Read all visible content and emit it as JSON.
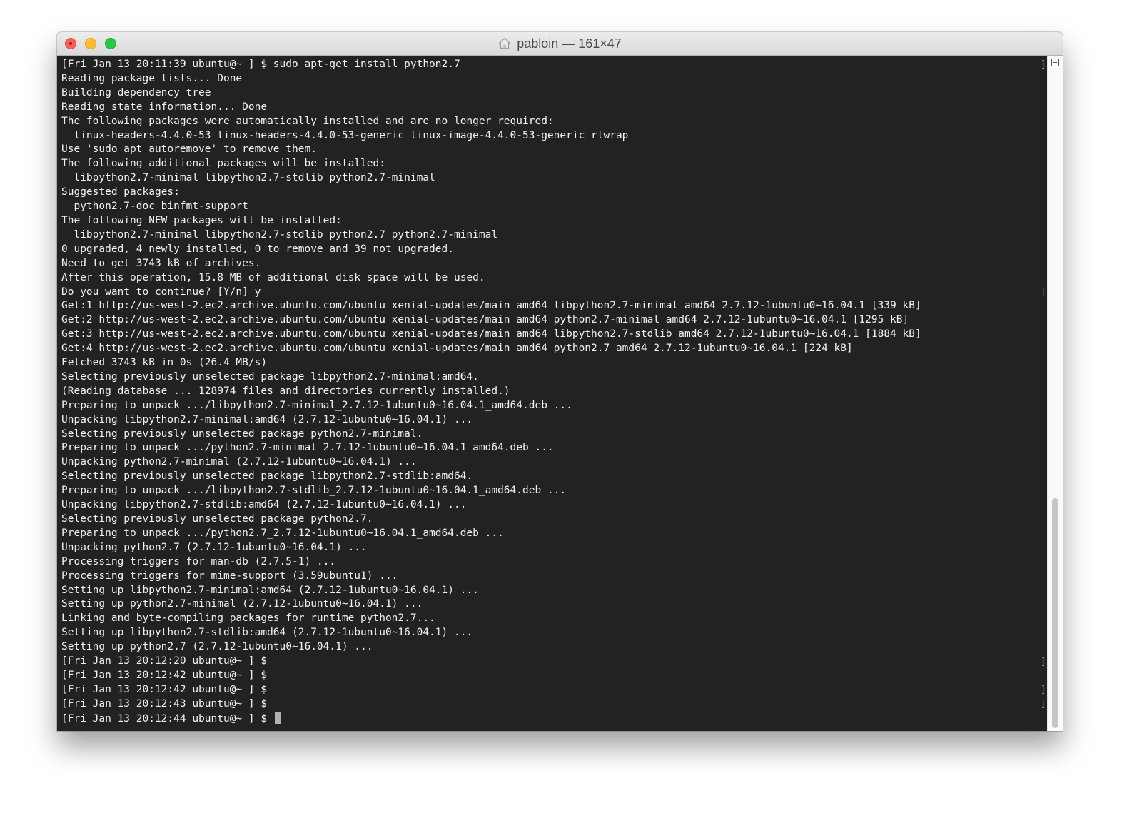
{
  "window": {
    "title": "pabloin — 161×47"
  },
  "terminal": {
    "lines": [
      {
        "text": "[Fri Jan 13 20:11:39 ubuntu@~ ] $ sudo apt-get install python2.7",
        "mark": true
      },
      {
        "text": "Reading package lists... Done"
      },
      {
        "text": "Building dependency tree"
      },
      {
        "text": "Reading state information... Done"
      },
      {
        "text": "The following packages were automatically installed and are no longer required:"
      },
      {
        "text": "  linux-headers-4.4.0-53 linux-headers-4.4.0-53-generic linux-image-4.4.0-53-generic rlwrap"
      },
      {
        "text": "Use 'sudo apt autoremove' to remove them."
      },
      {
        "text": "The following additional packages will be installed:"
      },
      {
        "text": "  libpython2.7-minimal libpython2.7-stdlib python2.7-minimal"
      },
      {
        "text": "Suggested packages:"
      },
      {
        "text": "  python2.7-doc binfmt-support"
      },
      {
        "text": "The following NEW packages will be installed:"
      },
      {
        "text": "  libpython2.7-minimal libpython2.7-stdlib python2.7 python2.7-minimal"
      },
      {
        "text": "0 upgraded, 4 newly installed, 0 to remove and 39 not upgraded."
      },
      {
        "text": "Need to get 3743 kB of archives."
      },
      {
        "text": "After this operation, 15.8 MB of additional disk space will be used."
      },
      {
        "text": "Do you want to continue? [Y/n] y",
        "mark": true
      },
      {
        "text": "Get:1 http://us-west-2.ec2.archive.ubuntu.com/ubuntu xenial-updates/main amd64 libpython2.7-minimal amd64 2.7.12-1ubuntu0~16.04.1 [339 kB]"
      },
      {
        "text": "Get:2 http://us-west-2.ec2.archive.ubuntu.com/ubuntu xenial-updates/main amd64 python2.7-minimal amd64 2.7.12-1ubuntu0~16.04.1 [1295 kB]"
      },
      {
        "text": "Get:3 http://us-west-2.ec2.archive.ubuntu.com/ubuntu xenial-updates/main amd64 libpython2.7-stdlib amd64 2.7.12-1ubuntu0~16.04.1 [1884 kB]"
      },
      {
        "text": "Get:4 http://us-west-2.ec2.archive.ubuntu.com/ubuntu xenial-updates/main amd64 python2.7 amd64 2.7.12-1ubuntu0~16.04.1 [224 kB]"
      },
      {
        "text": "Fetched 3743 kB in 0s (26.4 MB/s)"
      },
      {
        "text": "Selecting previously unselected package libpython2.7-minimal:amd64."
      },
      {
        "text": "(Reading database ... 128974 files and directories currently installed.)"
      },
      {
        "text": "Preparing to unpack .../libpython2.7-minimal_2.7.12-1ubuntu0~16.04.1_amd64.deb ..."
      },
      {
        "text": "Unpacking libpython2.7-minimal:amd64 (2.7.12-1ubuntu0~16.04.1) ..."
      },
      {
        "text": "Selecting previously unselected package python2.7-minimal."
      },
      {
        "text": "Preparing to unpack .../python2.7-minimal_2.7.12-1ubuntu0~16.04.1_amd64.deb ..."
      },
      {
        "text": "Unpacking python2.7-minimal (2.7.12-1ubuntu0~16.04.1) ..."
      },
      {
        "text": "Selecting previously unselected package libpython2.7-stdlib:amd64."
      },
      {
        "text": "Preparing to unpack .../libpython2.7-stdlib_2.7.12-1ubuntu0~16.04.1_amd64.deb ..."
      },
      {
        "text": "Unpacking libpython2.7-stdlib:amd64 (2.7.12-1ubuntu0~16.04.1) ..."
      },
      {
        "text": "Selecting previously unselected package python2.7."
      },
      {
        "text": "Preparing to unpack .../python2.7_2.7.12-1ubuntu0~16.04.1_amd64.deb ..."
      },
      {
        "text": "Unpacking python2.7 (2.7.12-1ubuntu0~16.04.1) ..."
      },
      {
        "text": "Processing triggers for man-db (2.7.5-1) ..."
      },
      {
        "text": "Processing triggers for mime-support (3.59ubuntu1) ..."
      },
      {
        "text": "Setting up libpython2.7-minimal:amd64 (2.7.12-1ubuntu0~16.04.1) ..."
      },
      {
        "text": "Setting up python2.7-minimal (2.7.12-1ubuntu0~16.04.1) ..."
      },
      {
        "text": "Linking and byte-compiling packages for runtime python2.7..."
      },
      {
        "text": "Setting up libpython2.7-stdlib:amd64 (2.7.12-1ubuntu0~16.04.1) ..."
      },
      {
        "text": "Setting up python2.7 (2.7.12-1ubuntu0~16.04.1) ..."
      },
      {
        "text": "[Fri Jan 13 20:12:20 ubuntu@~ ] $",
        "mark": true
      },
      {
        "text": "[Fri Jan 13 20:12:42 ubuntu@~ ] $"
      },
      {
        "text": "[Fri Jan 13 20:12:42 ubuntu@~ ] $",
        "mark": true
      },
      {
        "text": "[Fri Jan 13 20:12:43 ubuntu@~ ] $",
        "mark": true
      },
      {
        "text": "[Fri Jan 13 20:12:44 ubuntu@~ ] $ ",
        "cursor": true
      }
    ]
  },
  "colors": {
    "background": "#222222",
    "foreground": "#f2f2f2",
    "close": "#fc5f57",
    "minimize": "#fdbc2e",
    "zoom": "#28c840"
  }
}
